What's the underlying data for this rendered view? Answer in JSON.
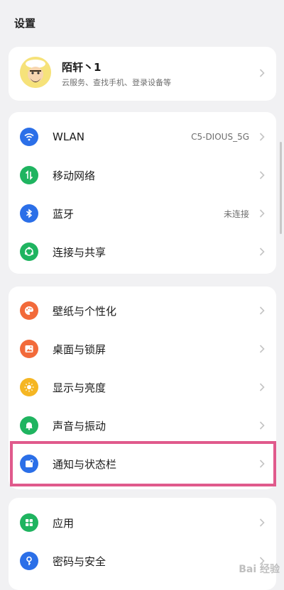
{
  "header": {
    "title": "设置"
  },
  "profile": {
    "name": "陌轩丶1",
    "subtitle": "云服务、查找手机、登录设备等",
    "avatar_icon": "cartoon-avatar"
  },
  "group1": [
    {
      "label": "WLAN",
      "value": "C5-DIOUS_5G",
      "icon": "wifi-icon",
      "color": "#2b6fe8"
    },
    {
      "label": "移动网络",
      "value": "",
      "icon": "mobile-data-icon",
      "color": "#1fb460"
    },
    {
      "label": "蓝牙",
      "value": "未连接",
      "icon": "bluetooth-icon",
      "color": "#2b6fe8"
    },
    {
      "label": "连接与共享",
      "value": "",
      "icon": "share-icon",
      "color": "#1fb460"
    }
  ],
  "group2": [
    {
      "label": "壁纸与个性化",
      "icon": "palette-icon",
      "color": "#f26a3a"
    },
    {
      "label": "桌面与锁屏",
      "icon": "image-icon",
      "color": "#f26a3a"
    },
    {
      "label": "显示与亮度",
      "icon": "sun-icon",
      "color": "#f5b623"
    },
    {
      "label": "声音与振动",
      "icon": "bell-icon",
      "color": "#1fb460"
    },
    {
      "label": "通知与状态栏",
      "icon": "notification-icon",
      "color": "#2b6fe8"
    }
  ],
  "group3": [
    {
      "label": "应用",
      "icon": "apps-grid-icon",
      "color": "#1fb460"
    },
    {
      "label": "密码与安全",
      "icon": "key-icon",
      "color": "#2b6fe8"
    }
  ],
  "watermark": "Bai 经验"
}
